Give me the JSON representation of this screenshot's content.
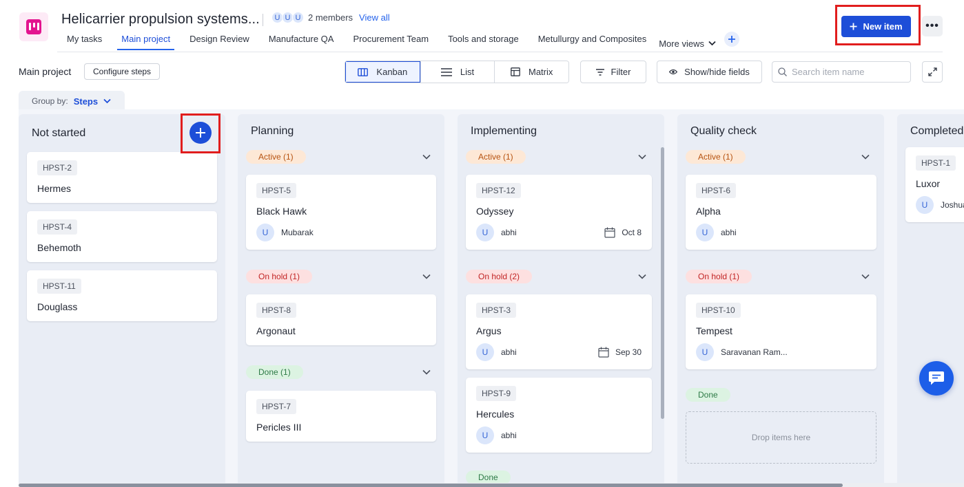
{
  "header": {
    "title": "Helicarrier propulsion systems...",
    "member_initials": [
      "U",
      "U",
      "U"
    ],
    "members_count": "2 members",
    "view_all": "View all",
    "new_item": "New item",
    "more": "•••",
    "add_view_icon": "plus-icon",
    "more_views": "More views",
    "tabs": [
      {
        "label": "My tasks"
      },
      {
        "label": "Main project",
        "active": true
      },
      {
        "label": "Design Review"
      },
      {
        "label": "Manufacture QA"
      },
      {
        "label": "Procurement Team"
      },
      {
        "label": "Tools and storage"
      },
      {
        "label": "Metullurgy and Composites"
      }
    ]
  },
  "toolbar": {
    "title": "Main project",
    "configure": "Configure steps",
    "views": [
      "Kanban",
      "List",
      "Matrix"
    ],
    "active_view": "Kanban",
    "filter": "Filter",
    "show_hide": "Show/hide fields",
    "search_placeholder": "Search item name",
    "group_by_label": "Group by:",
    "group_by_value": "Steps"
  },
  "colors": {
    "accent": "#1d4ed8",
    "highlight_box": "#e11d1d",
    "active_pill": "#fde8d6",
    "onhold_pill": "#fde0e0",
    "done_pill": "#dcf3e2"
  },
  "board": {
    "columns": [
      {
        "title": "Not started",
        "cards": [
          {
            "id": "HPST-2",
            "title": "Hermes"
          },
          {
            "id": "HPST-4",
            "title": "Behemoth"
          },
          {
            "id": "HPST-11",
            "title": "Douglass"
          }
        ]
      },
      {
        "title": "Planning",
        "groups": [
          {
            "label": "Active (1)",
            "cards": [
              {
                "id": "HPST-5",
                "title": "Black Hawk",
                "user": "Mubarak",
                "avatar": "U"
              }
            ]
          },
          {
            "label": "On hold (1)",
            "cards": [
              {
                "id": "HPST-8",
                "title": "Argonaut"
              }
            ]
          },
          {
            "label": "Done (1)",
            "cards": [
              {
                "id": "HPST-7",
                "title": "Pericles III"
              }
            ]
          }
        ]
      },
      {
        "title": "Implementing",
        "groups": [
          {
            "label": "Active (1)",
            "cards": [
              {
                "id": "HPST-12",
                "title": "Odyssey",
                "user": "abhi",
                "avatar": "U",
                "date": "Oct 8"
              }
            ]
          },
          {
            "label": "On hold (2)",
            "cards": [
              {
                "id": "HPST-3",
                "title": "Argus",
                "user": "abhi",
                "avatar": "U",
                "date": "Sep 30"
              },
              {
                "id": "HPST-9",
                "title": "Hercules",
                "user": "abhi",
                "avatar": "U"
              }
            ]
          },
          {
            "label": "Done"
          }
        ]
      },
      {
        "title": "Quality check",
        "groups": [
          {
            "label": "Active (1)",
            "cards": [
              {
                "id": "HPST-6",
                "title": "Alpha",
                "user": "abhi",
                "avatar": "U"
              }
            ]
          },
          {
            "label": "On hold (1)",
            "cards": [
              {
                "id": "HPST-10",
                "title": "Tempest",
                "user": "Saravanan Ram...",
                "avatar": "U"
              }
            ]
          },
          {
            "label": "Done",
            "drop_text": "Drop items here"
          }
        ]
      },
      {
        "title": "Completed",
        "cards": [
          {
            "id": "HPST-1",
            "title": "Luxor",
            "user": "Joshua",
            "avatar": "U"
          }
        ]
      }
    ]
  }
}
